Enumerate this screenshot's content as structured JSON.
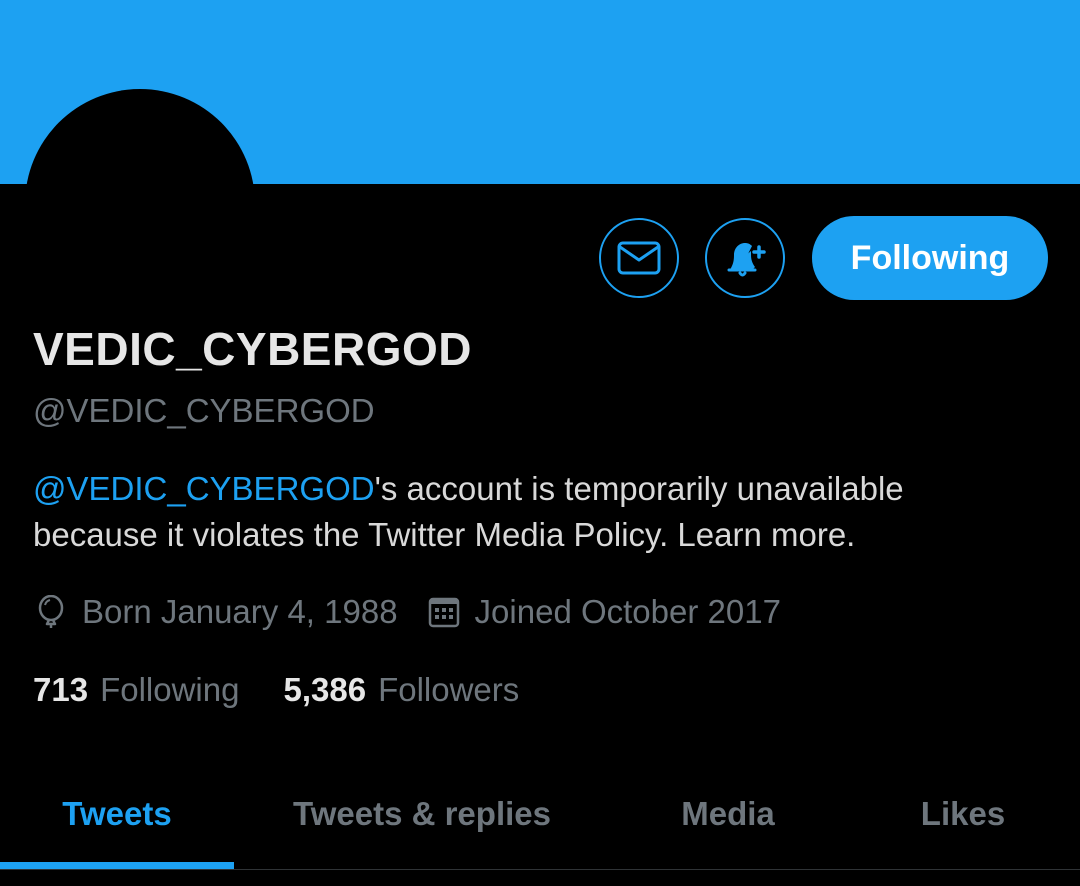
{
  "profile": {
    "display_name": "VEDIC_CYBERGOD",
    "handle": "@VEDIC_CYBERGOD",
    "bio_mention": "@VEDIC_CYBERGOD",
    "bio_line1_rest": "'s account is temporarily unavailable",
    "bio_line2": "because it violates the Twitter Media Policy. Learn more.",
    "born": "Born January 4, 1988",
    "joined": "Joined October 2017",
    "following_count": "713",
    "following_label": "Following",
    "followers_count": "5,386",
    "followers_label": "Followers"
  },
  "actions": {
    "message_icon": "envelope-icon",
    "notify_icon": "bell-plus-icon",
    "follow_label": "Following"
  },
  "tabs": [
    {
      "label": "Tweets",
      "active": true
    },
    {
      "label": "Tweets & replies",
      "active": false
    },
    {
      "label": "Media",
      "active": false
    },
    {
      "label": "Likes",
      "active": false
    }
  ],
  "colors": {
    "accent": "#1da1f2",
    "background": "#000000",
    "muted_text": "#6e767d",
    "primary_text": "#e6e6e6"
  }
}
